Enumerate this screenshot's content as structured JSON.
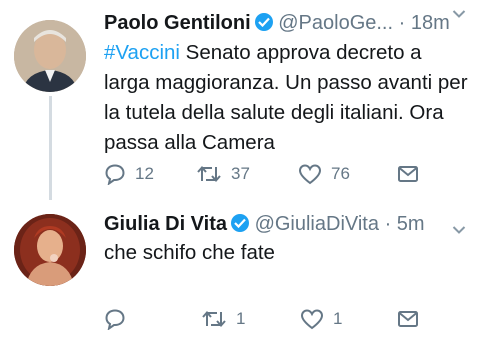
{
  "tweets": [
    {
      "avatar": "avatar-photo",
      "name": "Paolo Gentiloni",
      "verified": true,
      "handle": "@PaoloGe...",
      "separator": "·",
      "time": "18m",
      "hashtag": "#Vaccini",
      "text": " Senato approva decreto a larga maggioranza. Un passo avanti per la tutela della salute degli italiani. Ora passa alla Camera",
      "replies": "12",
      "retweets": "37",
      "likes": "76"
    },
    {
      "avatar": "avatar-photo",
      "name": "Giulia Di Vita",
      "verified": true,
      "handle": "@GiuliaDiVita",
      "separator": "·",
      "time": "5m",
      "text": "che schifo che fate",
      "replies": "",
      "retweets": "1",
      "likes": "1"
    }
  ],
  "colors": {
    "accent": "#1da1f2",
    "text": "#14171a",
    "muted": "#657786",
    "thread_line": "#d4dbe1"
  },
  "icons": [
    "verified-badge-icon",
    "chevron-down-icon",
    "reply-icon",
    "retweet-icon",
    "like-icon",
    "direct-message-icon"
  ]
}
